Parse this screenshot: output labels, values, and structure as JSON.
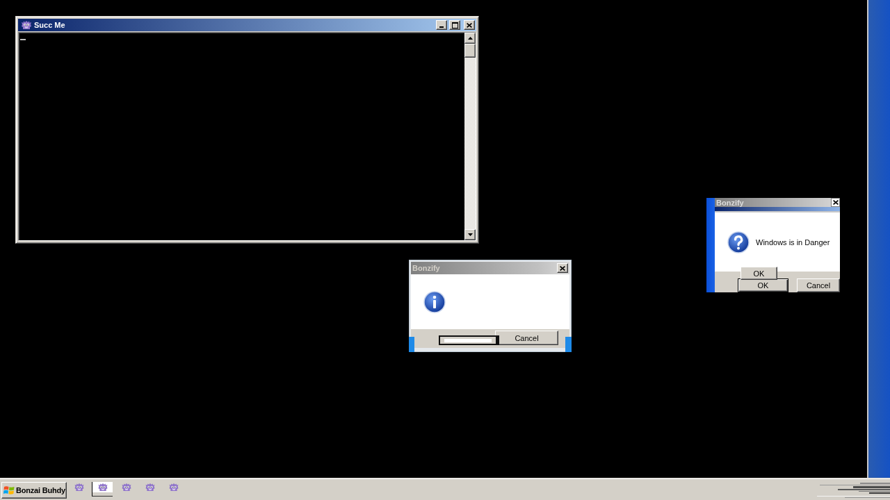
{
  "console_window": {
    "title": "Succ Me"
  },
  "dialogs": [
    {
      "title": "Bonzify",
      "kind": "question",
      "message": "Windows is in Danger",
      "buttons": [
        {
          "kind": "ghost",
          "label": "OK"
        },
        {
          "kind": "default",
          "label": "OK"
        },
        {
          "kind": "normal",
          "label": "Cancel"
        }
      ]
    },
    {
      "title": "Bonzify",
      "kind": "info",
      "buttons": [
        {
          "kind": "garbled"
        },
        {
          "kind": "normal",
          "label": "Cancel"
        }
      ]
    }
  ],
  "taskbar": {
    "start_button": {
      "label": "Bonzai Buhdy"
    },
    "tasks": [
      {
        "selected": false
      },
      {
        "selected": true
      },
      {
        "selected": false
      },
      {
        "selected": false
      },
      {
        "selected": false
      }
    ]
  }
}
